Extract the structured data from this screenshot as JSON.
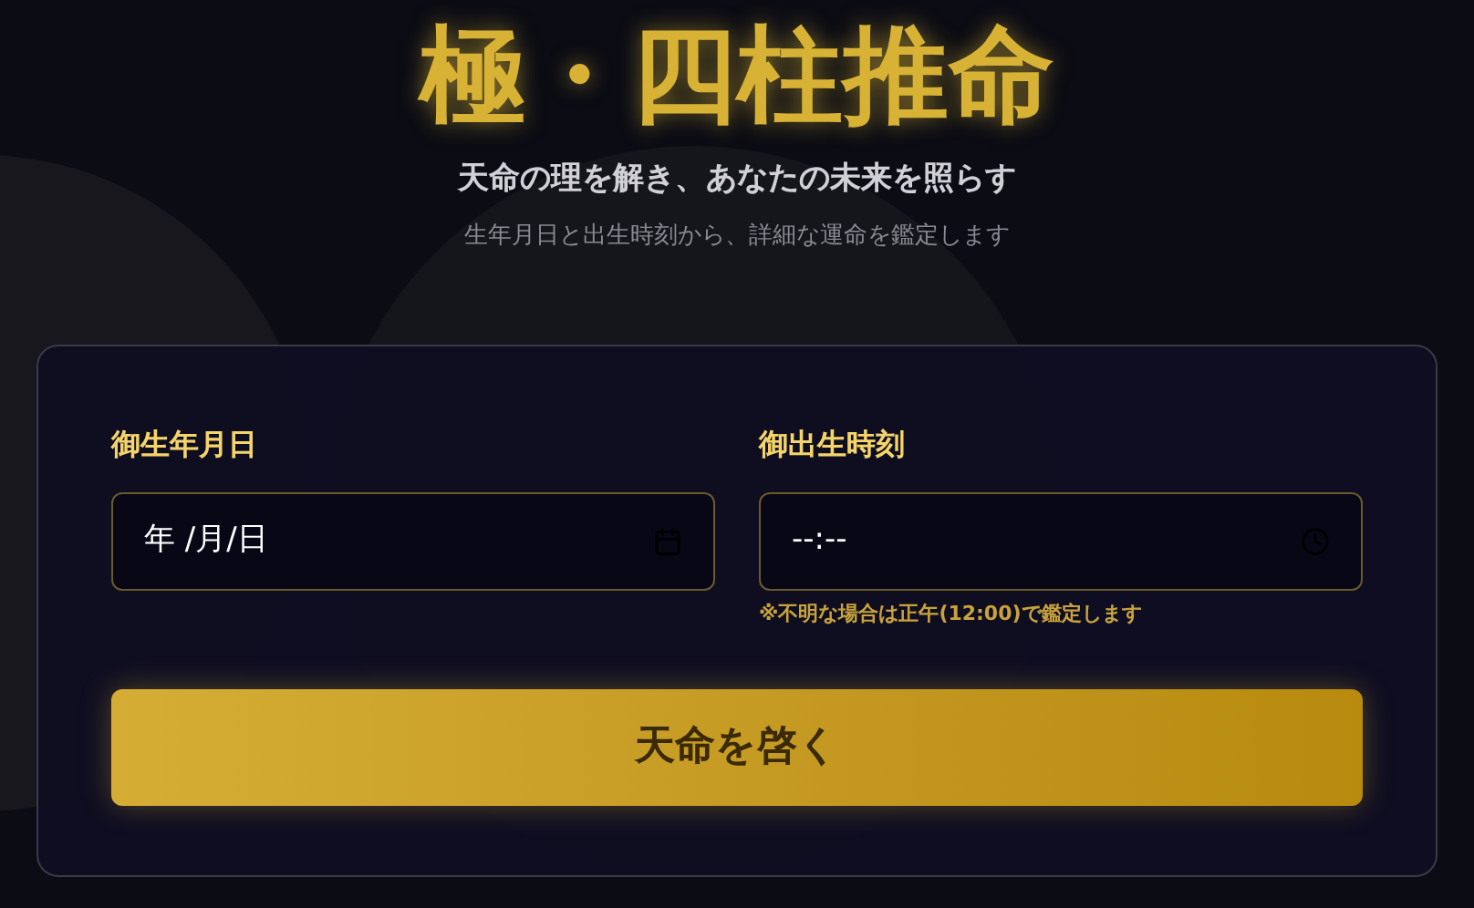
{
  "header": {
    "title": "極・四柱推命",
    "subtitle": "天命の理を解き、あなたの未来を照らす",
    "description": "生年月日と出生時刻から、詳細な運命を鑑定します"
  },
  "form": {
    "fields": [
      {
        "kind": "date",
        "label": "御生年月日",
        "value": "年 /月/日"
      },
      {
        "kind": "time",
        "label": "御出生時刻",
        "value": "--:--",
        "note": "※不明な場合は正午(12:00)で鑑定します"
      }
    ],
    "submit": "天命を啓く"
  }
}
